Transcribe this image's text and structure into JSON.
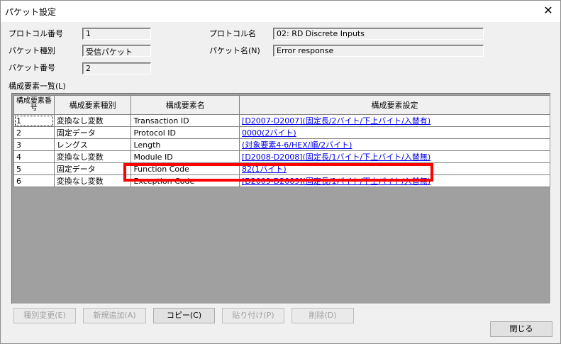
{
  "window": {
    "title": "パケット設定",
    "close_glyph": "✕"
  },
  "fields": {
    "protocol_no": {
      "label": "プロトコル番号",
      "value": "1"
    },
    "packet_type": {
      "label": "パケット種別",
      "value": "受信パケット"
    },
    "packet_no": {
      "label": "パケット番号",
      "value": "2"
    },
    "protocol_name": {
      "label": "プロトコル名",
      "value": "02: RD Discrete Inputs"
    },
    "packet_name": {
      "label": "パケット名(N)",
      "value": "Error response"
    }
  },
  "list_title": "構成要素一覧(L)",
  "table": {
    "headers": [
      "構成要素番号",
      "構成要素種別",
      "構成要素名",
      "構成要素設定"
    ],
    "rows": [
      {
        "no": "1",
        "type": "変換なし変数",
        "name": "Transaction ID",
        "setting": "[D2007-D2007](固定長/2バイト/下上バイト/入替有)"
      },
      {
        "no": "2",
        "type": "固定データ",
        "name": "Protocol ID",
        "setting": "0000(2バイト)"
      },
      {
        "no": "3",
        "type": "レングス",
        "name": "Length",
        "setting": "(対象要素4-6/HEX/順/2バイト)"
      },
      {
        "no": "4",
        "type": "変換なし変数",
        "name": "Module ID",
        "setting": "[D2008-D2008](固定長/1バイト/下上バイト/入替無)"
      },
      {
        "no": "5",
        "type": "固定データ",
        "name": "Function Code",
        "setting": "82(1バイト)"
      },
      {
        "no": "6",
        "type": "変換なし変数",
        "name": "Exception Code",
        "setting": "[D2009-D2009](固定長/1バイト/下上バイト/入替無)"
      }
    ]
  },
  "buttons": {
    "change_type": "種別変更(E)",
    "add_new": "新規追加(A)",
    "copy": "コピー(C)",
    "paste": "貼り付け(P)",
    "delete": "削除(D)",
    "close": "閉じる"
  },
  "colors": {
    "highlight": "#ff0000",
    "link": "#0000ee"
  }
}
